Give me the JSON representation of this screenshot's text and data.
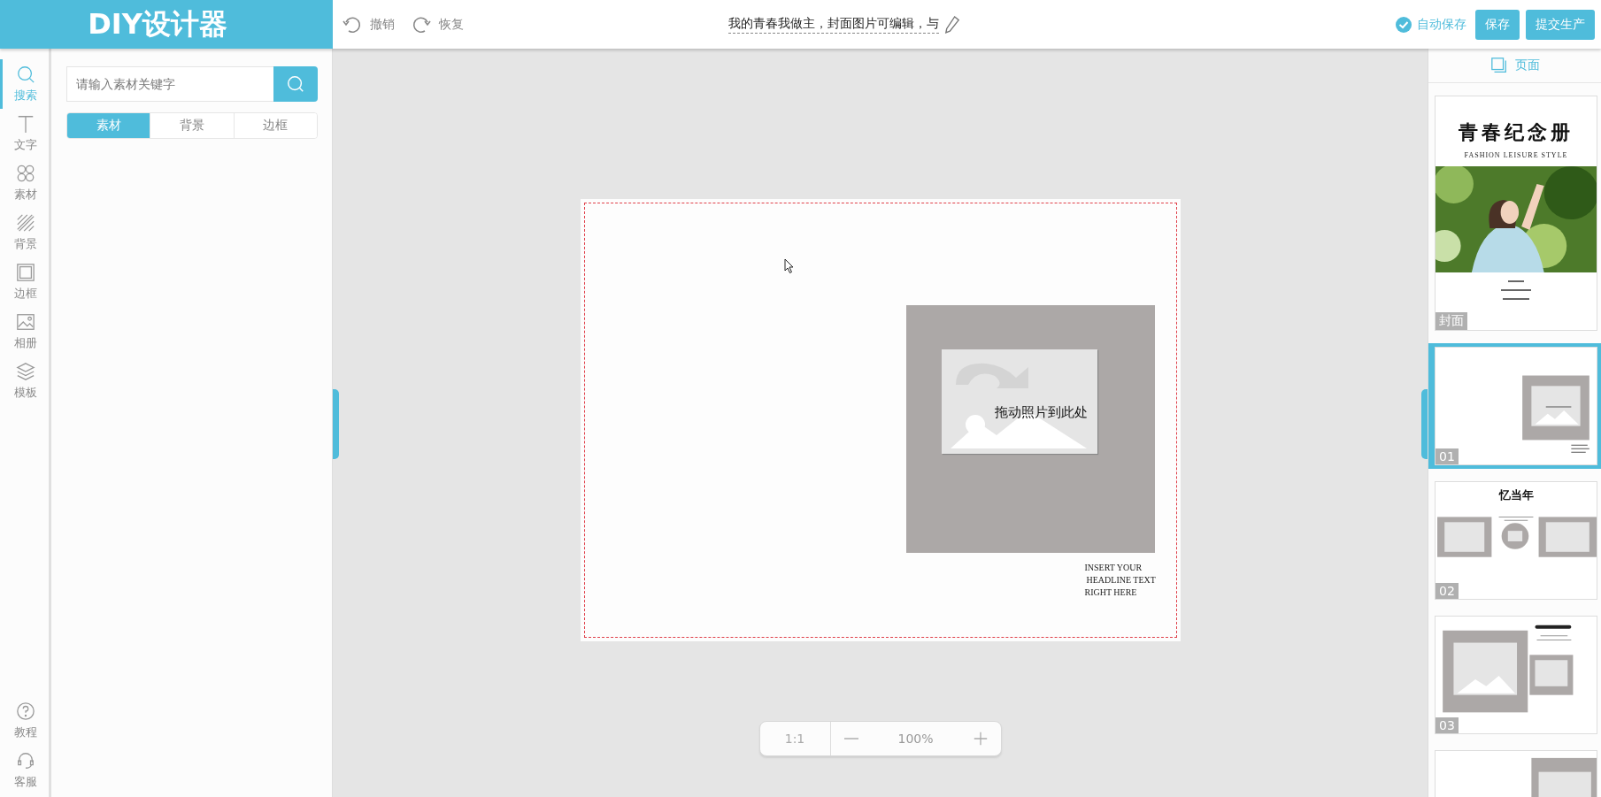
{
  "header": {
    "logo": "DIY设计器",
    "undo": "撤销",
    "redo": "恢复",
    "title": "我的青春我做主，封面图片可编辑，与",
    "autosave": {
      "label": "自动保存",
      "checked": true
    },
    "buttons": [
      "保存",
      "提交生产"
    ]
  },
  "tool_bar": {
    "items": [
      {
        "label": "搜索",
        "kind": "search",
        "selected": true
      },
      {
        "label": "文字",
        "kind": "text",
        "selected": false
      },
      {
        "label": "素材",
        "kind": "material",
        "selected": false
      },
      {
        "label": "背景",
        "kind": "background",
        "selected": false
      },
      {
        "label": "边框",
        "kind": "border",
        "selected": false
      },
      {
        "label": "相册",
        "kind": "album",
        "selected": false
      },
      {
        "label": "模板",
        "kind": "template",
        "selected": false
      }
    ],
    "bottom_items": [
      {
        "label": "教程",
        "kind": "help"
      },
      {
        "label": "客服",
        "kind": "service"
      }
    ]
  },
  "search_panel": {
    "placeholder": "请输入素材关键字",
    "tabs": [
      {
        "label": "素材",
        "selected": true
      },
      {
        "label": "背景",
        "selected": false
      },
      {
        "label": "边框",
        "selected": false
      }
    ]
  },
  "canvas": {
    "placeholder": "拖动照片到此处",
    "headline": [
      "INSERT YOUR",
      "HEADLINE TEXT",
      "RIGHT HERE"
    ]
  },
  "zoom": {
    "reset": "1:1",
    "value": "100%"
  },
  "pages": {
    "tab": "页面",
    "items": [
      {
        "label": "封面",
        "kind": "cover",
        "selected": false,
        "title": "青春纪念册",
        "subtitle": "FASHION LEISURE STYLE"
      },
      {
        "label": "01",
        "kind": "single",
        "selected": true
      },
      {
        "label": "02",
        "kind": "triple",
        "selected": false,
        "title": "忆当年"
      },
      {
        "label": "03",
        "kind": "double",
        "selected": false
      },
      {
        "kind": "circles",
        "selected": false
      }
    ]
  }
}
